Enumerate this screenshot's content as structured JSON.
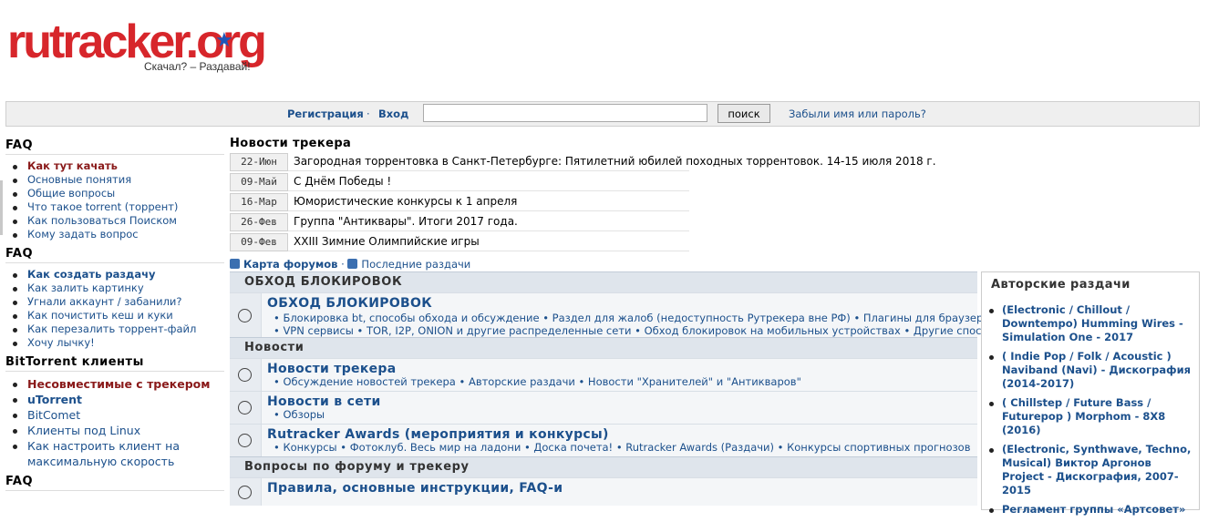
{
  "logo": {
    "ru": "rutracker",
    "org": "org",
    "dot": ".",
    "slogan": "Скачал? – Раздавай!"
  },
  "topbar": {
    "register": "Регистрация",
    "separator": "·",
    "login": "Вход",
    "search_value": "",
    "search_button": "поиск",
    "forgot": "Забыли имя или пароль?"
  },
  "sidebar": {
    "sections": [
      {
        "title": "FAQ",
        "items": [
          "Как тут качать",
          "Основные понятия",
          "Общие вопросы",
          "Что такое torrent (торрент)",
          "Как пользоваться Поиском",
          "Кому задать вопрос"
        ]
      },
      {
        "title": "FAQ",
        "items": [
          "Как создать раздачу",
          "Как залить картинку",
          "Угнали аккаунт / забанили?",
          "Как почистить кеш и куки",
          "Как перезалить торрент-файл",
          "Хочу лычку!"
        ]
      },
      {
        "title": "BitTorrent клиенты",
        "items": [
          "Несовместимые с трекером",
          "uTorrent",
          "BitComet",
          "Клиенты под Linux",
          "Как настроить клиент на",
          "максимальную скорость"
        ]
      },
      {
        "title": "FAQ",
        "items": []
      }
    ]
  },
  "news": {
    "title": "Новости трекера",
    "items": [
      {
        "date": "22-Июн",
        "text": "Загородная торрентовка в Санкт-Петербурге: Пятилетний юбилей походных торрентовок. 14-15 июля 2018 г."
      },
      {
        "date": "09-Май",
        "text": "С Днём Победы !"
      },
      {
        "date": "16-Мар",
        "text": "Юмористические конкурсы к 1 апреля"
      },
      {
        "date": "26-Фев",
        "text": "Группа \"Антиквары\". Итоги 2017 года."
      },
      {
        "date": "09-Фев",
        "text": "XXIII Зимние Олимпийские игры"
      }
    ],
    "map_link": "Карта форумов",
    "map_sep": "·",
    "recent_link": "Последние раздачи"
  },
  "forum": {
    "categories": [
      {
        "title": "ОБХОД БЛОКИРОВОК"
      },
      {
        "title": "Новости"
      },
      {
        "title": "Вопросы по форуму и трекеру"
      }
    ],
    "forums": [
      {
        "title": "ОБХОД БЛОКИРОВОК",
        "sub1": "• Блокировка bt, способы обхода и обсуждение • Раздел для жалоб (недоступность Рутрекера вне РФ) • Плагины для браузеров",
        "sub2": "• VPN сервисы • TOR, I2P, ONION и другие распределенные сети • Обход блокировок на мобильных устройствах • Другие способы"
      },
      {
        "title": "Новости трекера",
        "sub1": "• Обсуждение новостей трекера • Авторские раздачи • Новости \"Хранителей\" и \"Антикваров\""
      },
      {
        "title": "Новости в сети",
        "sub1": "• Обзоры"
      },
      {
        "title": "Rutracker Awards (мероприятия и конкурсы)",
        "sub1": "• Конкурсы • Фотоклуб. Весь мир на ладони • Доска почета! • Rutracker Awards (Раздачи) • Конкурсы спортивных прогнозов"
      },
      {
        "title": "Правила, основные инструкции, FAQ-и"
      }
    ]
  },
  "author_box": {
    "title": "Авторские раздачи",
    "items": [
      "(Electronic / Chillout / Downtempo) Humming Wires - Simulation One - 2017",
      "( Indie Pop / Folk / Acoustic ) Naviband (Navi) - Дискография (2014-2017)",
      "( Chillstep / Future Bass / Futurepop ) Morphom - 8X8 (2016)",
      "(Electronic, Synthwave, Techno, Musical) Виктор Аргонов Project - Дискография, 2007-2015",
      "Регламент группы «Артсовет»"
    ]
  }
}
